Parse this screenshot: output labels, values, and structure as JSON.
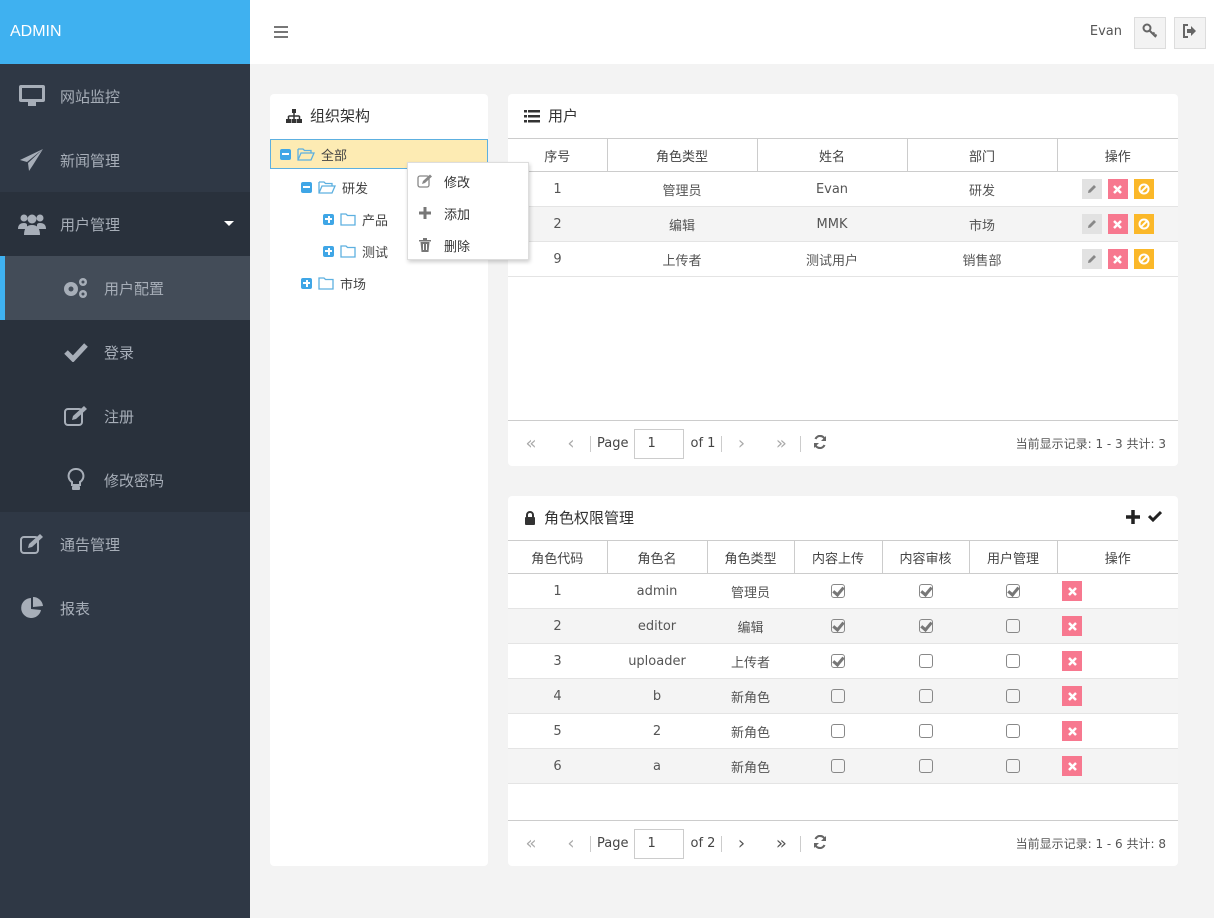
{
  "brand": "ADMIN",
  "colors": {
    "brand": "#3fb1f0",
    "sidebar": "#2f3845",
    "delete": "#f7788f",
    "disable": "#fbb829",
    "selected_node": "#fdebb3"
  },
  "sidebar": {
    "items": [
      {
        "label": "网站监控",
        "icon": "monitor-icon"
      },
      {
        "label": "新闻管理",
        "icon": "paper-plane-icon"
      },
      {
        "label": "用户管理",
        "icon": "users-icon",
        "expanded": true,
        "children": [
          {
            "label": "用户配置",
            "icon": "gears-icon",
            "active": true
          },
          {
            "label": "登录",
            "icon": "check-icon"
          },
          {
            "label": "注册",
            "icon": "edit-icon"
          },
          {
            "label": "修改密码",
            "icon": "lightbulb-icon"
          }
        ]
      },
      {
        "label": "通告管理",
        "icon": "edit-icon"
      },
      {
        "label": "报表",
        "icon": "pie-chart-icon"
      }
    ]
  },
  "header": {
    "user": "Evan",
    "buttons": [
      "key-icon",
      "logout-icon"
    ]
  },
  "org_tree": {
    "title": "组织架构",
    "nodes": [
      {
        "label": "全部",
        "expanded": true,
        "selected": true,
        "level": 0
      },
      {
        "label": "研发",
        "expanded": true,
        "level": 1
      },
      {
        "label": "产品",
        "expanded": false,
        "level": 2
      },
      {
        "label": "测试",
        "expanded": false,
        "level": 2
      },
      {
        "label": "市场",
        "expanded": false,
        "level": 1
      }
    ],
    "context_menu": [
      {
        "label": "修改",
        "icon": "edit-icon"
      },
      {
        "label": "添加",
        "icon": "plus-icon"
      },
      {
        "label": "删除",
        "icon": "trash-icon"
      }
    ]
  },
  "users": {
    "title": "用户",
    "columns": [
      "序号",
      "角色类型",
      "姓名",
      "部门",
      "操作"
    ],
    "rows": [
      {
        "id": "1",
        "role": "管理员",
        "name": "Evan",
        "dept": "研发"
      },
      {
        "id": "2",
        "role": "编辑",
        "name": "MMK",
        "dept": "市场"
      },
      {
        "id": "9",
        "role": "上传者",
        "name": "测试用户",
        "dept": "销售部"
      }
    ],
    "pager": {
      "page_label": "Page",
      "page": "1",
      "of": "of 1",
      "info": "当前显示记录: 1 - 3 共计: 3"
    }
  },
  "roles": {
    "title": "角色权限管理",
    "columns": [
      "角色代码",
      "角色名",
      "角色类型",
      "内容上传",
      "内容审核",
      "用户管理",
      "操作"
    ],
    "rows": [
      {
        "code": "1",
        "name": "admin",
        "type": "管理员",
        "upload": true,
        "review": true,
        "manage": true
      },
      {
        "code": "2",
        "name": "editor",
        "type": "编辑",
        "upload": true,
        "review": true,
        "manage": false
      },
      {
        "code": "3",
        "name": "uploader",
        "type": "上传者",
        "upload": true,
        "review": false,
        "manage": false
      },
      {
        "code": "4",
        "name": "b",
        "type": "新角色",
        "upload": false,
        "review": false,
        "manage": false
      },
      {
        "code": "5",
        "name": "2",
        "type": "新角色",
        "upload": false,
        "review": false,
        "manage": false
      },
      {
        "code": "6",
        "name": "a",
        "type": "新角色",
        "upload": false,
        "review": false,
        "manage": false
      }
    ],
    "pager": {
      "page_label": "Page",
      "page": "1",
      "of": "of 2",
      "info": "当前显示记录: 1 - 6 共计: 8"
    }
  }
}
